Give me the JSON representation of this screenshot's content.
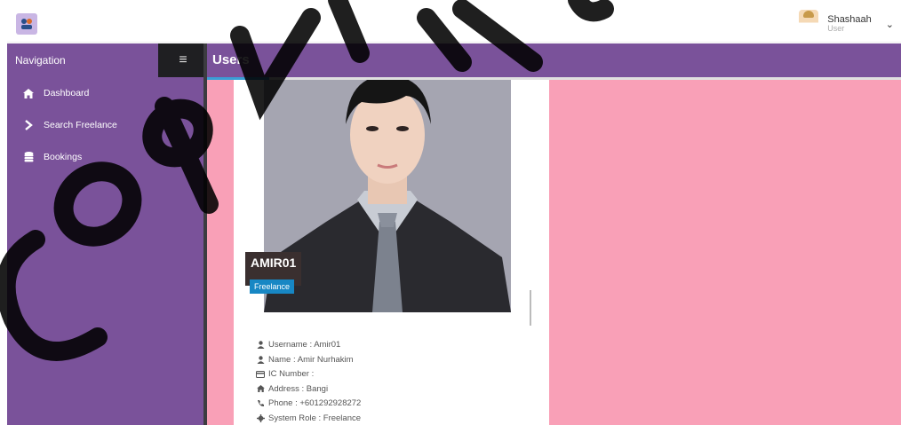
{
  "topbar": {
    "user": {
      "name": "Shashaah",
      "role": "User"
    }
  },
  "sidebar": {
    "title": "Navigation",
    "items": [
      {
        "label": "Dashboard",
        "icon": "home-icon"
      },
      {
        "label": "Search Freelance",
        "icon": "chevron-right-icon"
      },
      {
        "label": "Bookings",
        "icon": "database-icon"
      }
    ]
  },
  "header": {
    "title": "Users"
  },
  "profile": {
    "display_name": "AMIR01",
    "role_badge": "Freelance",
    "details": [
      {
        "icon": "user-icon",
        "text": "Username : Amir01"
      },
      {
        "icon": "user-icon",
        "text": "Name : Amir Nurhakim"
      },
      {
        "icon": "id-card-icon",
        "text": "IC Number :"
      },
      {
        "icon": "home-icon",
        "text": "Address : Bangi"
      },
      {
        "icon": "phone-icon",
        "text": "Phone : +601292928272"
      },
      {
        "icon": "gear-icon",
        "text": "System Role : Freelance"
      }
    ]
  },
  "watermark": {
    "text": "Copyright"
  },
  "colors": {
    "sidebar": "#7a529a",
    "main_background": "#f9a0b7",
    "badge": "#1787c4",
    "accent": "#3a9fd6"
  }
}
